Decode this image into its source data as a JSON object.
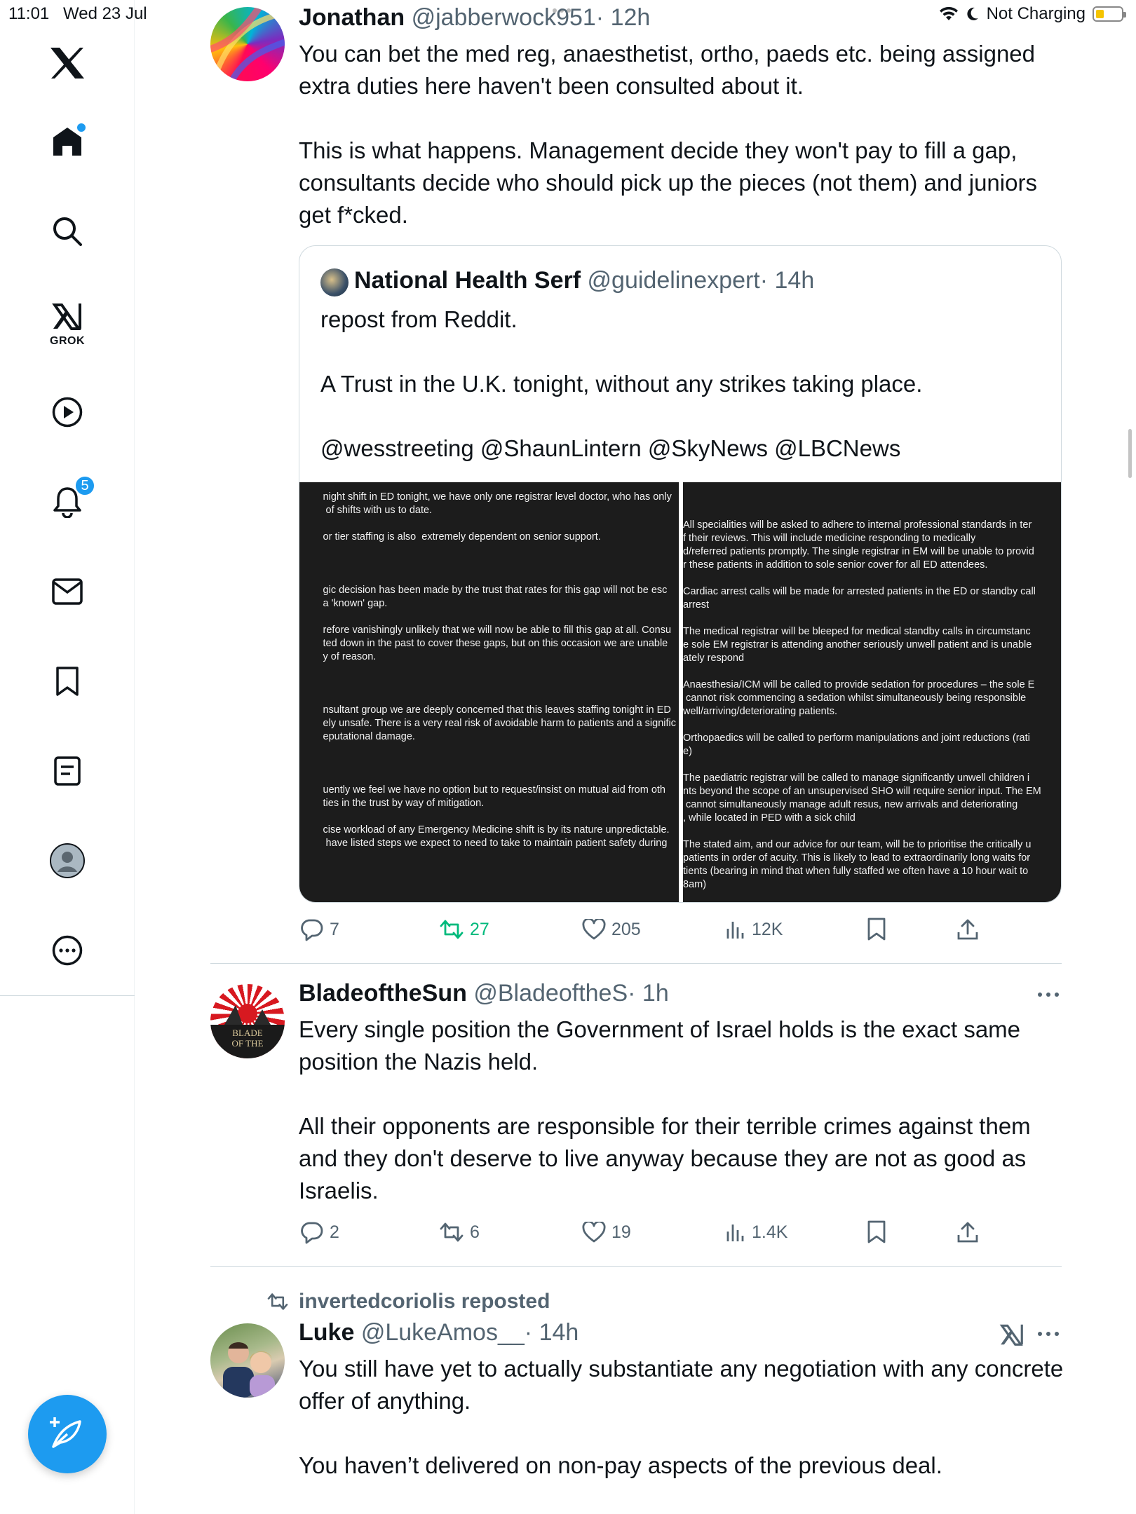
{
  "status_bar": {
    "time": "11:01",
    "date": "Wed 23 Jul",
    "charging": "Not Charging",
    "battery_level": 0.3
  },
  "sidebar": {
    "items": [
      {
        "icon": "x-logo-icon"
      },
      {
        "icon": "home-icon",
        "dot": true
      },
      {
        "icon": "search-icon"
      },
      {
        "icon": "grok-icon",
        "label": "GROK"
      },
      {
        "icon": "video-play-icon"
      },
      {
        "icon": "notifications-bell-icon",
        "badge": "5"
      },
      {
        "icon": "messages-envelope-icon"
      },
      {
        "icon": "bookmark-icon"
      },
      {
        "icon": "lists-icon"
      },
      {
        "icon": "profile-avatar-icon"
      },
      {
        "icon": "more-circle-icon"
      }
    ],
    "compose_icon": "compose-feather-icon"
  },
  "colors": {
    "accent": "#1d9bf0",
    "repost_green": "#00ba7c",
    "secondary_text": "#536471"
  },
  "tweets": [
    {
      "name": "Jonathan",
      "handle": "@jabberwock951",
      "time": "· 12h",
      "text": "You can bet the med reg, anaesthetist, ortho, paeds etc. being assigned extra duties here haven't been consulted about it.\n\nThis is what happens. Management decide they won't pay to fill a gap, consultants decide who should pick up the pieces (not them) and juniors get f*cked.",
      "quote": {
        "name": "National Health Serf",
        "handle": "@guidelinexpert",
        "time": "· 14h",
        "text": "repost from Reddit.\n\nA Trust in the U.K. tonight, without any strikes taking place.\n\n@wesstreeting @ShaunLintern @SkyNews @LBCNews",
        "image_left_text": "night shift in ED tonight, we have only one registrar level doctor, who has only\n of shifts with us to date.\n\nor tier staffing is also  extremely dependent on senior support.\n\n\n\ngic decision has been made by the trust that rates for this gap will not be esc\na 'known' gap.\n\nrefore vanishingly unlikely that we will now be able to fill this gap at all. Consu\nted down in the past to cover these gaps, but on this occasion we are unable\ny of reason.\n\n\n\nnsultant group we are deeply concerned that this leaves staffing tonight in ED\nely unsafe. There is a very real risk of avoidable harm to patients and a signific\neputational damage.\n\n\n\nuently we feel we have no option but to request/insist on mutual aid from oth\nties in the trust by way of mitigation.\n\ncise workload of any Emergency Medicine shift is by its nature unpredictable.\n have listed steps we expect to need to take to maintain patient safety during",
        "image_right_text": "All specialities will be asked to adhere to internal professional standards in ter\nf their reviews. This will include medicine responding to medically\nd/referred patients promptly. The single registrar in EM will be unable to provid\nr these patients in addition to sole senior cover for all ED attendees.\n\nCardiac arrest calls will be made for arrested patients in the ED or standby call\narrest\n\nThe medical registrar will be bleeped for medical standby calls in circumstanc\ne sole EM registrar is attending another seriously unwell patient and is unable\nately respond\n\nAnaesthesia/ICM will be called to provide sedation for procedures – the sole E\n cannot risk commencing a sedation whilst simultaneously being responsible\nwell/arriving/deteriorating patients.\n\nOrthopaedics will be called to perform manipulations and joint reductions (rati\ne)\n\nThe paediatric registrar will be called to manage significantly unwell children i\nnts beyond the scope of an unsupervised SHO will require senior input. The EM\n cannot simultaneously manage adult resus, new arrivals and deteriorating\n, while located in PED with a sick child\n\nThe stated aim, and our advice for our team, will be to prioritise the critically u\npatients in order of acuity. This is likely to lead to extraordinarily long waits for\ntients (bearing in mind that when fully staffed we often have a 10 hour wait to\n8am)"
      },
      "replies": "7",
      "reposts": "27",
      "likes": "205",
      "views": "12K"
    },
    {
      "name": "BladeoftheSun",
      "handle": "@BladeoftheS",
      "time": "· 1h",
      "text": "Every single position the Government of Israel holds is the exact same position the Nazis held.\n\nAll their opponents are responsible for their terrible crimes against them and they don't deserve to live anyway because they are not as good as Israelis.",
      "avatar_text": "BLADE\nOF THE",
      "replies": "2",
      "reposts": "6",
      "likes": "19",
      "views": "1.4K"
    },
    {
      "reposted_by": "invertedcoriolis reposted",
      "name": "Luke",
      "handle": "@LukeAmos__",
      "time": "· 14h",
      "text": "You still have yet to actually substantiate any negotiation with any concrete offer of anything.\n\nYou haven’t delivered on non-pay aspects of the previous deal."
    }
  ]
}
